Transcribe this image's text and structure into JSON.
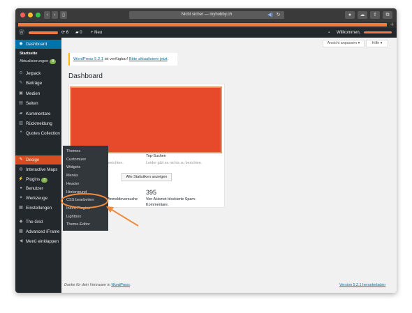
{
  "browser": {
    "url": "Nicht sicher — myhobby.ch",
    "lock_label": "Nicht sicher",
    "tab_plus": "+"
  },
  "adminbar": {
    "comments_count": "6",
    "updates_count": "0",
    "new_label": "+ Neu",
    "welcome": "Willkommen,"
  },
  "sidebar": {
    "dashboard": "Dashboard",
    "start": "Startseite",
    "updates": "Aktualisierungen",
    "updates_badge": "8",
    "items": [
      {
        "label": "Jetpack",
        "icon": "jetpack-icon",
        "glyph": "⊙"
      },
      {
        "label": "Beiträge",
        "icon": "pin-icon",
        "glyph": "✎"
      },
      {
        "label": "Medien",
        "icon": "media-icon",
        "glyph": "▣"
      },
      {
        "label": "Seiten",
        "icon": "page-icon",
        "glyph": "▤"
      },
      {
        "label": "Kommentare",
        "icon": "comment-icon",
        "glyph": "▰"
      },
      {
        "label": "Rückmeldung",
        "icon": "feedback-icon",
        "glyph": "▥"
      },
      {
        "label": "Quotes Collection",
        "icon": "quotes-icon",
        "glyph": "❝"
      }
    ],
    "items2": [
      {
        "label": "Design",
        "icon": "brush-icon",
        "glyph": "✎"
      },
      {
        "label": "Interactive Maps",
        "icon": "map-icon",
        "glyph": "◍"
      },
      {
        "label": "Plugins",
        "icon": "plugin-icon",
        "glyph": "⚡",
        "badge": "3"
      },
      {
        "label": "Benutzer",
        "icon": "user-icon",
        "glyph": "●"
      },
      {
        "label": "Werkzeuge",
        "icon": "tools-icon",
        "glyph": "✦"
      },
      {
        "label": "Einstellungen",
        "icon": "settings-icon",
        "glyph": "▦"
      }
    ],
    "items3": [
      {
        "label": "The Grid",
        "icon": "grid-icon",
        "glyph": "◆"
      },
      {
        "label": "Advanced iFrame",
        "icon": "iframe-icon",
        "glyph": "▩"
      },
      {
        "label": "Menü einklappen",
        "icon": "collapse-icon",
        "glyph": "◀"
      }
    ]
  },
  "main": {
    "screen_options": "Ansicht anpassen ▾",
    "help": "Hilfe ▾",
    "notice_prefix": "WordPress 5.2.1",
    "notice_middle": " ist verfügbar! ",
    "notice_link": "Bitte aktualisiere jetzt",
    "notice_end": ".",
    "title": "Dashboard",
    "report_text": "zu berichten.",
    "top_search_title": "Top-Suchen",
    "top_search_text": "Leider gibt es nichts zu berichten.",
    "stats_button": "Alle Statistiken anzeigen",
    "login_text": "Anmeldeversuche",
    "spam_count": "395",
    "spam_text_1": "Von Akismet blockierte Spam-",
    "spam_text_2": "Kommentare."
  },
  "design_menu": [
    "Themes",
    "Customizer",
    "Widgets",
    "Menüs",
    "Header",
    "Hintergrund",
    "CSS bearbeiten",
    "Insert Plugins",
    "Lightbox",
    "Theme-Editor"
  ],
  "footer": {
    "left_prefix": "Danke für dein Vertrauen in ",
    "left_link": "WordPress",
    "left_end": ".",
    "right": "Version 5.2.1 herunterladen"
  },
  "colors": {
    "accent": "#0073aa",
    "admin_bg": "#23282d",
    "highlight": "#d54e21",
    "annotation": "#f08a3e"
  }
}
